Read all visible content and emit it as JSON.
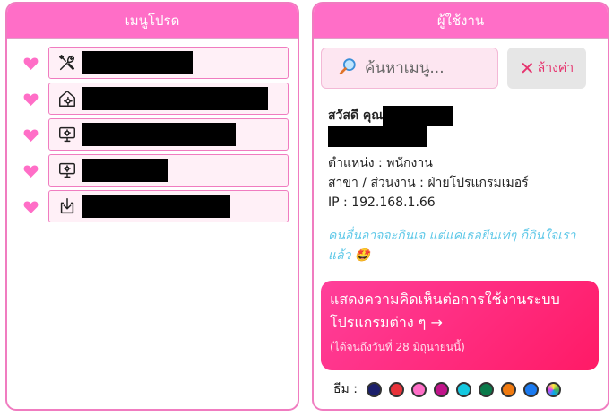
{
  "left_panel": {
    "title": "เมนูโปรด",
    "items": [
      {
        "icon": "tools-icon",
        "label": ""
      },
      {
        "icon": "gear-house-icon",
        "label": ""
      },
      {
        "icon": "monitor-settings-icon",
        "label": ""
      },
      {
        "icon": "monitor-settings-icon",
        "label": ""
      },
      {
        "icon": "download-icon",
        "label": ""
      }
    ]
  },
  "right_panel": {
    "title": "ผู้ใช้งาน",
    "search": {
      "placeholder": "ค้นหาเมนู...",
      "value": "",
      "icon": "magnifier-icon"
    },
    "clear_button": {
      "x": "✕",
      "label": "ล้างค่า"
    },
    "user": {
      "greeting": "สวัสดี คุณ",
      "position": "ตำแหน่ง : พนักงาน",
      "department": "สาขา / ส่วนงาน : ฝ่ายโปรแกรมเมอร์",
      "ip": "IP : 192.168.1.66"
    },
    "quote": {
      "text": "คนอื่นอาจจะกินเจ แต่แค่เธอยืนเท่ๆ ก็กินใจเรา แล้ว",
      "emoji": "🤩"
    },
    "feedback": {
      "title": "แสดงความคิดเห็นต่อการใช้งานระบบโปรแกรมต่าง ๆ →",
      "subtitle": "(ได้จนถึงวันที่ 28 มิถุนายนนี้)"
    },
    "theme": {
      "label": "ธีม :",
      "colors": [
        "#1b1f6b",
        "#e8333a",
        "#ff6ec7",
        "#c0148a",
        "#14c8e0",
        "#0a7a4a",
        "#f07a10",
        "#1a7af0",
        "rainbow"
      ]
    }
  },
  "colors": {
    "accent": "#ff6ec7",
    "border": "#f07cc0",
    "feedback": "#ff2a7a",
    "quote": "#5ec8e8"
  }
}
